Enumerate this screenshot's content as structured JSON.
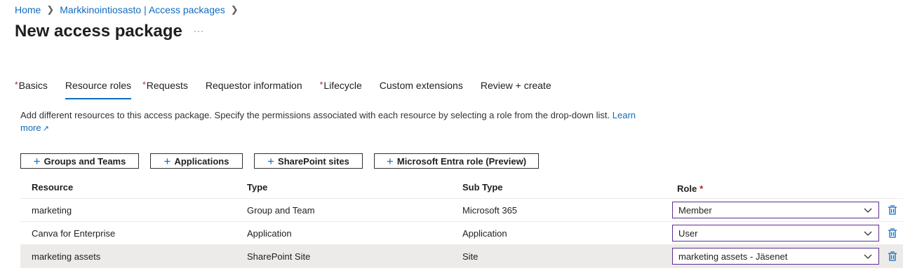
{
  "breadcrumb": {
    "home": "Home",
    "parent": "Markkinointiosasto | Access packages"
  },
  "page": {
    "title": "New access package",
    "more": "···"
  },
  "tabs": [
    {
      "label": "Basics",
      "required": true
    },
    {
      "label": "Resource roles",
      "required": false,
      "active": true
    },
    {
      "label": "Requests",
      "required": true
    },
    {
      "label": "Requestor information",
      "required": false
    },
    {
      "label": "Lifecycle",
      "required": true
    },
    {
      "label": "Custom extensions",
      "required": false
    },
    {
      "label": "Review + create",
      "required": false
    }
  ],
  "description": {
    "text": "Add different resources to this access package. Specify the permissions associated with each resource by selecting a role from the drop-down list. ",
    "link1": "Learn",
    "link2": "more"
  },
  "toolbar": {
    "groups": "Groups and Teams",
    "applications": "Applications",
    "sharepoint": "SharePoint sites",
    "entra": "Microsoft Entra role (Preview)"
  },
  "table": {
    "headers": {
      "resource": "Resource",
      "type": "Type",
      "subtype": "Sub Type",
      "role": "Role",
      "role_required": "*"
    },
    "rows": [
      {
        "resource": "marketing",
        "type": "Group and Team",
        "subtype": "Microsoft 365",
        "role": "Member"
      },
      {
        "resource": "Canva for Enterprise",
        "type": "Application",
        "subtype": "Application",
        "role": "User"
      },
      {
        "resource": "marketing assets",
        "type": "SharePoint Site",
        "subtype": "Site",
        "role": "marketing assets - Jäsenet"
      }
    ]
  },
  "colors": {
    "accent": "#0f6cbd",
    "required": "#a4262c",
    "select_border": "#5c2e91"
  }
}
